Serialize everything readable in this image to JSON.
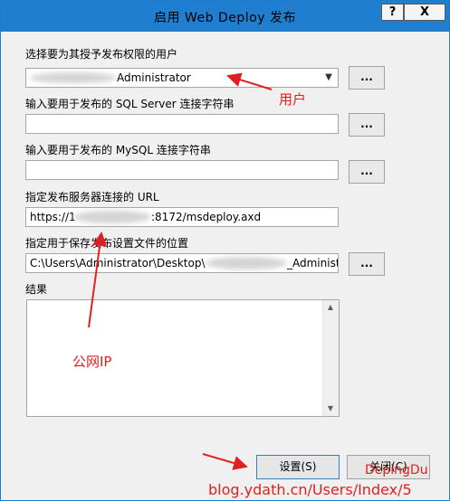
{
  "window": {
    "title": "启用 Web Deploy 发布",
    "help_label": "?",
    "close_label": "X"
  },
  "form": {
    "user_label": "选择要为其授予发布权限的用户",
    "user_value": "Administrator",
    "sql_label": "输入要用于发布的 SQL Server 连接字符串",
    "sql_value": "",
    "mysql_label": "输入要用于发布的 MySQL 连接字符串",
    "mysql_value": "",
    "url_label": "指定发布服务器连接的 URL",
    "url_prefix": "https://1",
    "url_suffix": ":8172/msdeploy.axd",
    "path_label": "指定用于保存发布设置文件的位置",
    "path_prefix": "C:\\Users\\Administrator\\Desktop\\",
    "path_suffix": "_Administ",
    "results_label": "结果",
    "browse_label": "..."
  },
  "buttons": {
    "setup": "设置(S)",
    "close": "关闭(C)"
  },
  "annotations": {
    "user": "用户",
    "public_ip": "公网IP",
    "author": "DepingDu",
    "blog": "blog.ydath.cn/Users/Index/5"
  },
  "colors": {
    "title_bar": "#1f7ed0",
    "annotation": "#e02020"
  }
}
